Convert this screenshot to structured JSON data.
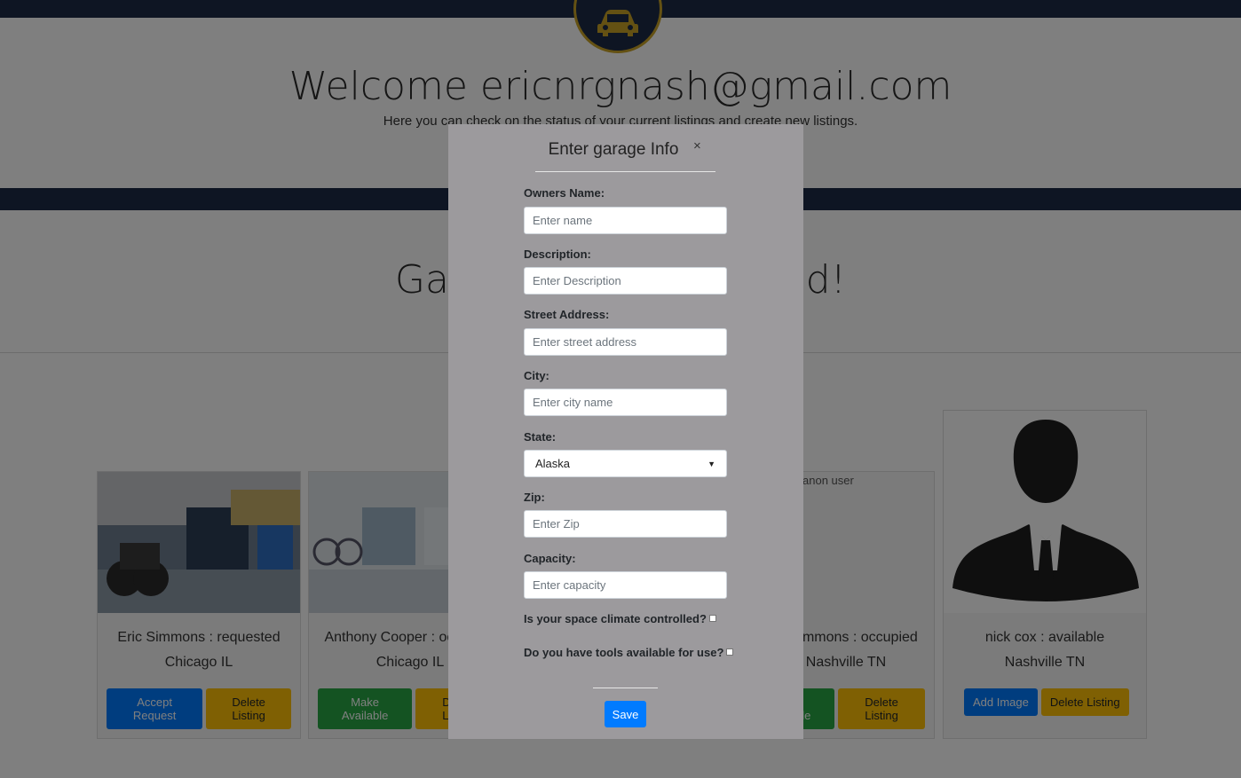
{
  "header": {
    "welcome": "Welcome ericnrgnash@gmail.com",
    "subtitle": "Here you can check on the status of your current listings and create new listings."
  },
  "section": {
    "heading": "Garage listings loaded!"
  },
  "cards": [
    {
      "name": "Eric Simmons : requested",
      "location": "Chicago IL",
      "buttons": [
        "Accept Request",
        "Delete Listing"
      ]
    },
    {
      "name": "Anthony Cooper : occupied",
      "location": "Chicago IL",
      "buttons": [
        "Make Available",
        "Delete Listing"
      ]
    },
    {
      "name": "eric simmons : occupied",
      "location": "Nashville TN",
      "image_alt": "anon user",
      "buttons": [
        "Make Available",
        "Delete Listing"
      ]
    },
    {
      "name": "nick cox : available",
      "location": "Nashville TN",
      "buttons": [
        "Add Image",
        "Delete Listing"
      ]
    }
  ],
  "modal": {
    "title": "Enter garage Info",
    "close": "×",
    "fields": [
      {
        "label": "Owners Name:",
        "placeholder": "Enter name"
      },
      {
        "label": "Description:",
        "placeholder": "Enter Description"
      },
      {
        "label": "Street Address:",
        "placeholder": "Enter street address"
      },
      {
        "label": "City:",
        "placeholder": "Enter city name"
      },
      {
        "label": "State:",
        "value": "Alaska"
      },
      {
        "label": "Zip:",
        "placeholder": "Enter Zip"
      },
      {
        "label": "Capacity:",
        "placeholder": "Enter capacity"
      }
    ],
    "climate_question": "Is your space climate controlled?",
    "tools_question": "Do you have tools available for use?",
    "save": "Save"
  },
  "colors": {
    "navy": "#1d2a47",
    "gold": "#c9a227",
    "primary": "#007bff",
    "success": "#28a745",
    "warning": "#ffc107"
  },
  "icons": {
    "logo": "car-icon",
    "select_arrow": "caret-down-icon"
  }
}
